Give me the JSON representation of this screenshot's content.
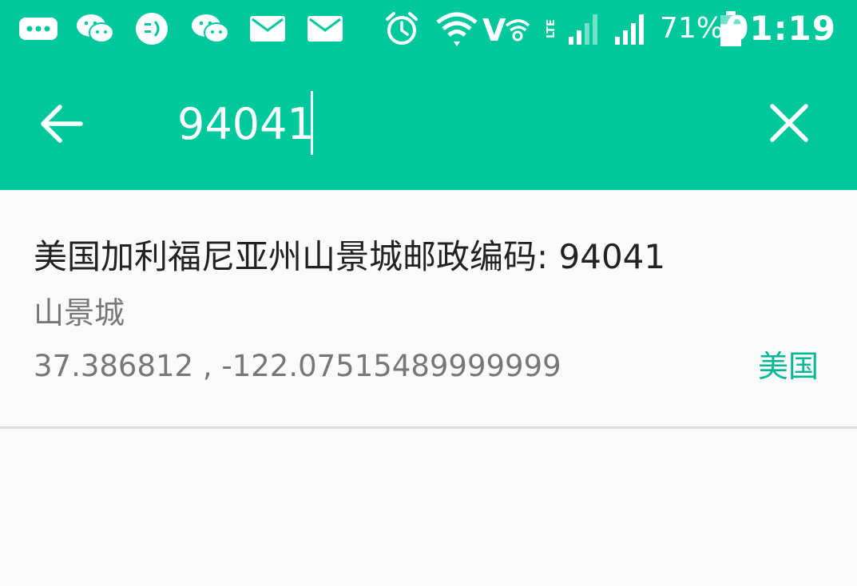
{
  "status_bar": {
    "icons": [
      "more-notifications-icon",
      "wechat-icon",
      "message-app-icon",
      "wechat-icon",
      "mail-icon",
      "mail-icon",
      "alarm-icon",
      "wifi-icon",
      "volte-icon",
      "signal-weak-icon",
      "signal-strong-icon"
    ],
    "battery_percent": "71%",
    "time": "01:19",
    "battery_level": 0.71
  },
  "search": {
    "value": "94041"
  },
  "colors": {
    "accent": "#00c89d",
    "country_text": "#00b894"
  },
  "results": [
    {
      "title": "美国加利福尼亚州山景城邮政编码: 94041",
      "city": "山景城",
      "coordinates": "37.386812 , -122.07515489999999",
      "country": "美国"
    }
  ]
}
